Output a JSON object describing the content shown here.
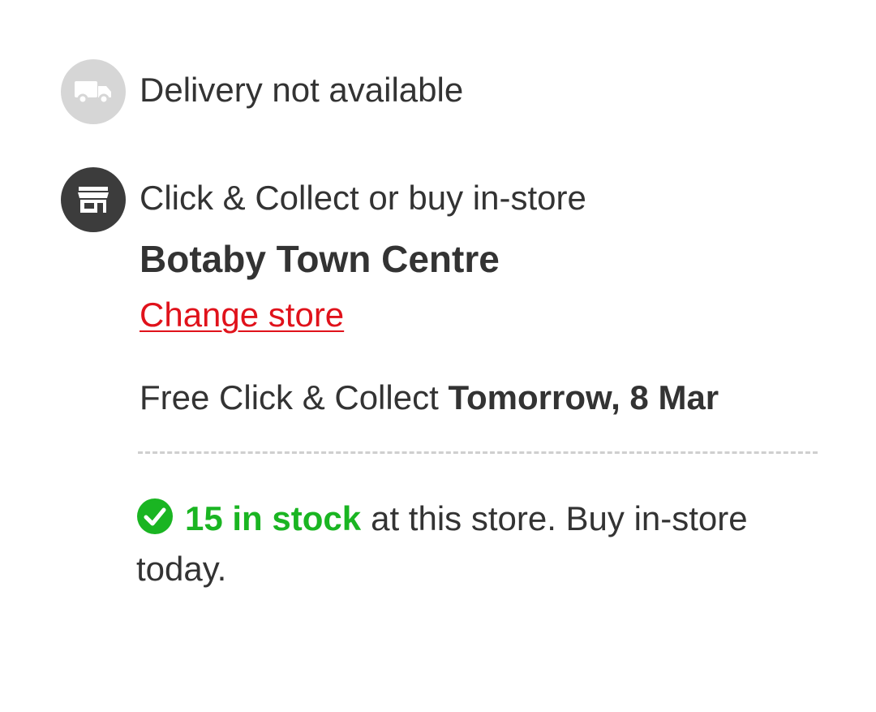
{
  "delivery": {
    "icon": "truck-icon",
    "text": "Delivery not available"
  },
  "collect": {
    "icon": "store-icon",
    "method_text": "Click & Collect or buy in-store",
    "store_name": "Botaby Town Centre",
    "change_store_label": "Change store",
    "free_collect_label": "Free Click & Collect",
    "collect_date": "Tomorrow, 8 Mar"
  },
  "stock": {
    "icon": "check-circle-icon",
    "count_text": "15 in stock",
    "detail_text": "at this store. Buy in-store today."
  },
  "colors": {
    "accent_red": "#e0121b",
    "stock_green": "#1ab522",
    "text_dark": "#333333",
    "delivery_icon_bg": "#d6d6d6",
    "store_icon_bg": "#3c3c3c"
  }
}
